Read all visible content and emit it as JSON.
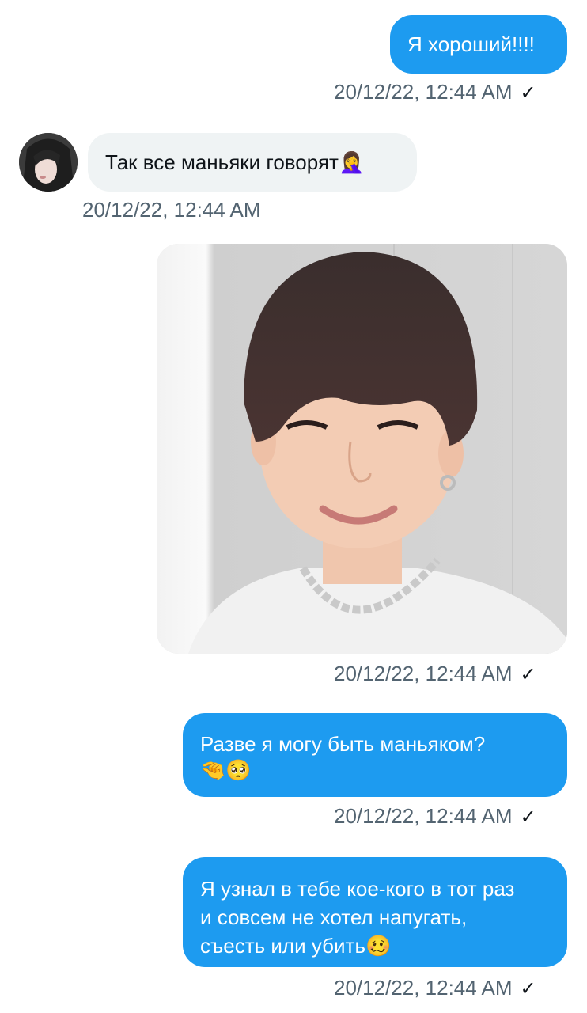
{
  "messages": [
    {
      "text": "Я хороший!!!!",
      "time": "20/12/22, 12:44 AM",
      "status": "✓"
    },
    {
      "text": "Так все маньяки говорят",
      "emoji": "🤦‍♀️",
      "time": "20/12/22, 12:44 AM"
    },
    {
      "time": "20/12/22, 12:44 AM",
      "status": "✓"
    },
    {
      "line1": "Разве я могу быть маньяком?",
      "line2_emoji": "🤏🥺",
      "time": "20/12/22, 12:44 AM",
      "status": "✓"
    },
    {
      "line1": "Я узнал в тебе кое-кого в тот раз",
      "line2": "и совсем не хотел напугать,",
      "line3": "съесть или убить",
      "line3_emoji": "🥴",
      "time": "20/12/22, 12:44 AM",
      "status": "✓"
    }
  ],
  "colors": {
    "outgoing_bubble": "#1d9bf0",
    "incoming_bubble": "#eff3f4",
    "timestamp": "#536471"
  },
  "icons": {
    "read_receipt": "check-icon",
    "sender_avatar": "avatar"
  }
}
